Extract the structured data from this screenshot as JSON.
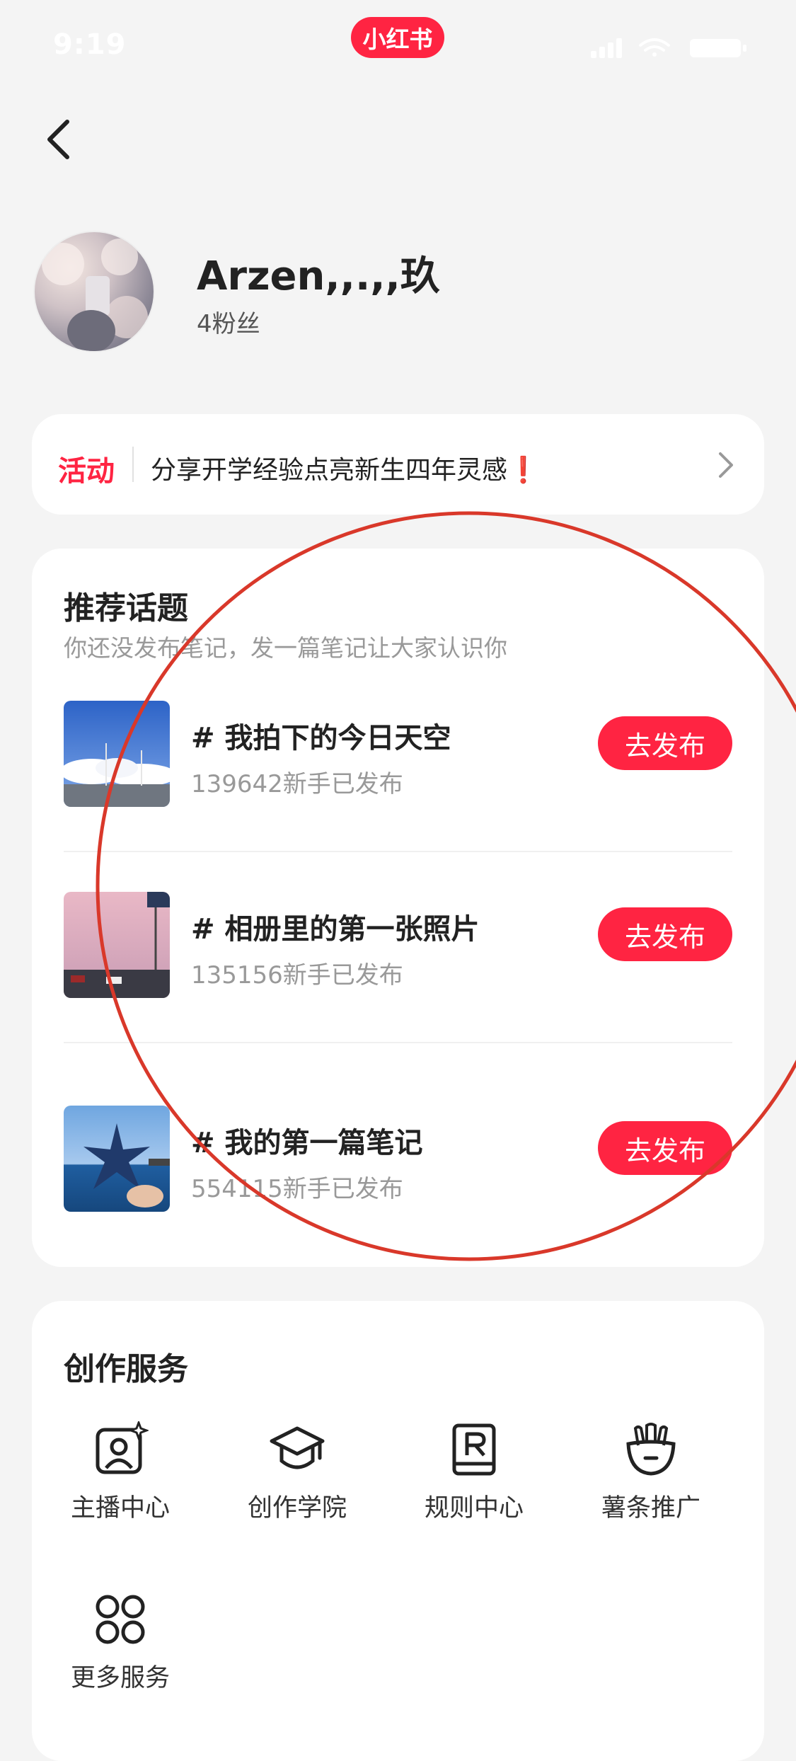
{
  "status_bar": {
    "time": "9:19"
  },
  "app_badge": "小红书",
  "profile": {
    "name": "Arzen,,.,,玖",
    "fans": "4粉丝"
  },
  "activity": {
    "tag": "活动",
    "text": "分享开学经验点亮新生四年灵感❗"
  },
  "topics": {
    "title": "推荐话题",
    "subtitle": "你还没发布笔记，发一篇笔记让大家认识你",
    "items": [
      {
        "title": "# 我拍下的今日天空",
        "count": "139642新手已发布",
        "button": "去发布"
      },
      {
        "title": "# 相册里的第一张照片",
        "count": "135156新手已发布",
        "button": "去发布"
      },
      {
        "title": "# 我的第一篇笔记",
        "count": "554115新手已发布",
        "button": "去发布"
      }
    ]
  },
  "services": {
    "title": "创作服务",
    "items": [
      {
        "label": "主播中心",
        "icon": "streamer-icon"
      },
      {
        "label": "创作学院",
        "icon": "graduation-cap-icon"
      },
      {
        "label": "规则中心",
        "icon": "rules-book-icon"
      },
      {
        "label": "薯条推广",
        "icon": "fries-icon"
      },
      {
        "label": "更多服务",
        "icon": "more-grid-icon"
      }
    ]
  },
  "colors": {
    "brand": "#ff2442",
    "annotation": "#d9382a"
  }
}
